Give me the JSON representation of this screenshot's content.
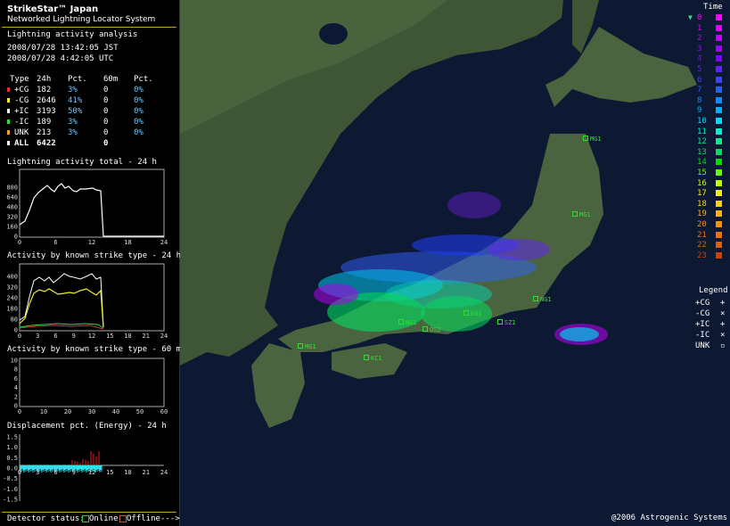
{
  "header": {
    "title": "StrikeStar™ Japan",
    "subtitle": "Networked Lightning Locator System"
  },
  "analysis": {
    "title": "Lightning activity analysis",
    "time_jst": "2008/07/28 13:42:05 JST",
    "time_utc": "2008/07/28 4:42:05 UTC",
    "columns": [
      "Type",
      "24h",
      "Pct.",
      "60m",
      "Pct."
    ],
    "rows": [
      {
        "type": "+CG",
        "h24": "182",
        "pct24": "3%",
        "m60": "0",
        "pct60": "0%",
        "color": "#e03030"
      },
      {
        "type": "-CG",
        "h24": "2646",
        "pct24": "41%",
        "m60": "0",
        "pct60": "0%",
        "color": "#f0f030"
      },
      {
        "type": "+IC",
        "h24": "3193",
        "pct24": "50%",
        "m60": "0",
        "pct60": "0%",
        "color": "#ffffff"
      },
      {
        "type": "-IC",
        "h24": "189",
        "pct24": "3%",
        "m60": "0",
        "pct60": "0%",
        "color": "#30e030"
      },
      {
        "type": "UNK",
        "h24": "213",
        "pct24": "3%",
        "m60": "0",
        "pct60": "0%",
        "color": "#f0a030"
      }
    ],
    "total": {
      "type": "ALL",
      "h24": "6422",
      "m60": "0"
    }
  },
  "charts": {
    "total_24h": {
      "title": "Lightning activity total - 24 h",
      "yticks": [
        "800",
        "640",
        "480",
        "320",
        "160",
        "0"
      ],
      "xticks": [
        "0",
        "6",
        "12",
        "18",
        "24"
      ]
    },
    "type_24h": {
      "title": "Activity by known strike type - 24 h",
      "yticks": [
        "400",
        "320",
        "240",
        "180",
        "80",
        "0"
      ],
      "xticks": [
        "0",
        "3",
        "6",
        "9",
        "12",
        "15",
        "18",
        "21",
        "24"
      ]
    },
    "type_60m": {
      "title": "Activity by known strike type - 60 min",
      "yticks": [
        "10",
        "8",
        "6",
        "4",
        "2",
        "0"
      ],
      "xticks": [
        "0",
        "10",
        "20",
        "30",
        "40",
        "50",
        "60"
      ]
    },
    "displacement": {
      "title": "Displacement pct. (Energy) - 24 h",
      "yticks": [
        "1.5",
        "1.0",
        "0.5",
        "0.0",
        "-0.5",
        "-1.0",
        "-1.5"
      ],
      "xticks": [
        "0",
        "3",
        "6",
        "9",
        "12",
        "15",
        "18",
        "21",
        "24"
      ]
    }
  },
  "status_bar": {
    "label": "Detector status:",
    "online": "Online",
    "offline": "Offline",
    "arrow": "--->"
  },
  "time_legend": {
    "title": "Time",
    "items": [
      {
        "label": "0",
        "color": "#ff00ff"
      },
      {
        "label": "1",
        "color": "#e000ff"
      },
      {
        "label": "2",
        "color": "#c000ff"
      },
      {
        "label": "3",
        "color": "#a000ff"
      },
      {
        "label": "4",
        "color": "#8000ff"
      },
      {
        "label": "5",
        "color": "#6020ff"
      },
      {
        "label": "6",
        "color": "#4040ff"
      },
      {
        "label": "7",
        "color": "#2060ff"
      },
      {
        "label": "8",
        "color": "#0090ff"
      },
      {
        "label": "9",
        "color": "#00b0ff"
      },
      {
        "label": "10",
        "color": "#00d8ff"
      },
      {
        "label": "11",
        "color": "#00f0d0"
      },
      {
        "label": "12",
        "color": "#00f090"
      },
      {
        "label": "13",
        "color": "#00e060"
      },
      {
        "label": "14",
        "color": "#00e000"
      },
      {
        "label": "15",
        "color": "#60ff00"
      },
      {
        "label": "16",
        "color": "#c0ff00"
      },
      {
        "label": "17",
        "color": "#f0f000"
      },
      {
        "label": "18",
        "color": "#ffd000"
      },
      {
        "label": "19",
        "color": "#ffb000"
      },
      {
        "label": "20",
        "color": "#ff9000"
      },
      {
        "label": "21",
        "color": "#f07000"
      },
      {
        "label": "22",
        "color": "#e06000"
      },
      {
        "label": "23",
        "color": "#d04000"
      }
    ]
  },
  "symbol_legend": {
    "title": "Legend",
    "items": [
      {
        "label": "+CG",
        "symbol": "+"
      },
      {
        "label": "-CG",
        "symbol": "×"
      },
      {
        "label": "+IC",
        "symbol": "+"
      },
      {
        "label": "-IC",
        "symbol": "×"
      },
      {
        "label": "UNK",
        "symbol": "▫"
      }
    ]
  },
  "stations": [
    "MG1",
    "MG1",
    "NG1",
    "KG1",
    "OS2",
    "NG1",
    "SZ1",
    "MG1",
    "KC1"
  ],
  "copyright": "@2006 Astrogenic Systems"
}
